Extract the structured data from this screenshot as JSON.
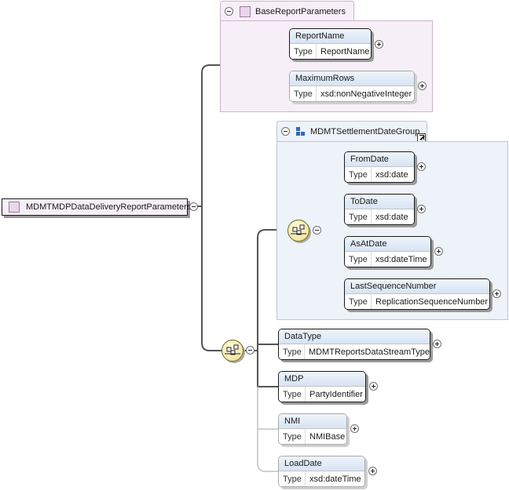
{
  "root": {
    "name": "MDMTMDPDataDeliveryReportParameters"
  },
  "type_label": "Type",
  "group": {
    "name": "BaseReportParameters",
    "elements": [
      {
        "name": "ReportName",
        "type": "ReportName",
        "optional": false
      },
      {
        "name": "MaximumRows",
        "type": "xsd:nonNegativeInteger",
        "optional": true
      }
    ]
  },
  "ref_group": {
    "name": "MDMTSettlementDateGroup",
    "elements": [
      {
        "name": "FromDate",
        "type": "xsd:date",
        "optional": false
      },
      {
        "name": "ToDate",
        "type": "xsd:date",
        "optional": false
      },
      {
        "name": "AsAtDate",
        "type": "xsd:dateTime",
        "optional": false
      },
      {
        "name": "LastSequenceNumber",
        "type": "ReplicationSequenceNumber",
        "optional": false
      }
    ]
  },
  "elements": [
    {
      "name": "DataType",
      "type": "MDMTReportsDataStreamType",
      "optional": false
    },
    {
      "name": "MDP",
      "type": "PartyIdentifier",
      "optional": false
    },
    {
      "name": "NMI",
      "type": "NMIBase",
      "optional": true
    },
    {
      "name": "LoadDate",
      "type": "xsd:dateTime",
      "optional": true
    }
  ],
  "icons": {
    "sequence": "sequence-compositor-icon",
    "group": "element-group-icon",
    "ref": "reference-arrow-icon",
    "toggle": "collapse-expand-icon"
  },
  "colors": {
    "group_bg": "#f7eff7",
    "ref_bg": "#eef3f9",
    "compositor": "#f3e7a4"
  }
}
